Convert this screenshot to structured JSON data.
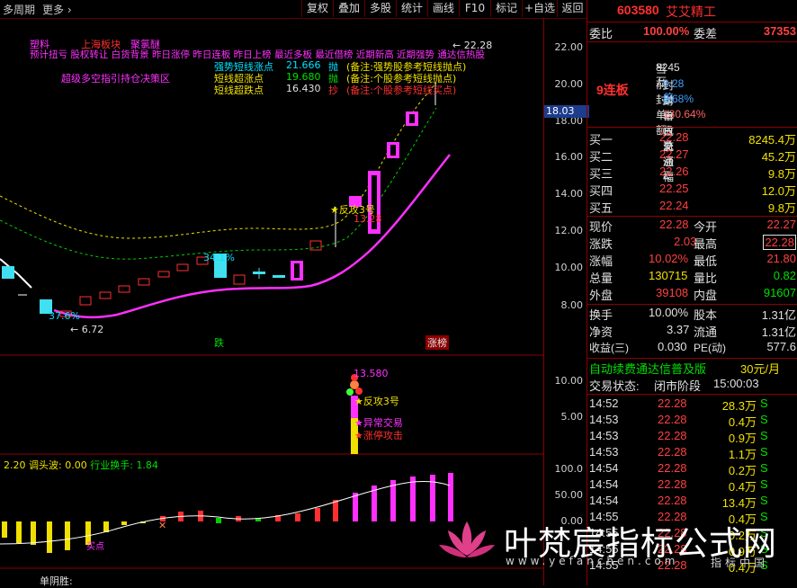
{
  "toolbar": {
    "period": "多周期",
    "more": "更多",
    "buttons": [
      "复权",
      "叠加",
      "多股",
      "统计",
      "画线",
      "F10",
      "标记",
      "+自选",
      "返回"
    ]
  },
  "chart": {
    "annotations": {
      "tag_plastic": "塑料",
      "tag_sector": "上海板块",
      "tag_polymer": "聚氯醚",
      "concept_line": "预计扭亏 股权转让 白货背景 昨日涨停 昨日连板 昨日上榜 最近多板 最近借榜 近期新高 近期强势 通达信热股",
      "super_long_bull": "超级多空指引持仓决策区",
      "strong_label": "强势短线涨点",
      "strong_value": "21.666",
      "strong_act": "抛",
      "strong_note": "(备注:强势股参考短线抛点)",
      "short_up_label": "短线超涨点",
      "short_up_value": "19.680",
      "short_up_act": "抛",
      "short_up_note": "(备注:个股参考短线抛点)",
      "short_down_label": "短线超跌点",
      "short_down_value": "16.430",
      "short_down_act": "抄",
      "short_down_note": "(备注:个股参考短线买点)",
      "high_mark": "22.28",
      "low_mark": "6.72",
      "pct_low": "37.6%",
      "pct_mid": "34.1%",
      "fangong_main": "反攻3号",
      "price_1328": "13.28",
      "die": "跌",
      "zhangbang": "涨榜",
      "price_axis_current": "18.03"
    },
    "price_axis": [
      "22.00",
      "20.00",
      "18.00",
      "16.00",
      "14.00",
      "12.00",
      "10.00",
      "8.00"
    ],
    "mid_axis": [
      "10.00",
      "5.00"
    ],
    "mid_annotations": {
      "value": "13.580",
      "fangong": "反攻3号",
      "yichang": "异常交易",
      "zhangting": "涨停攻击"
    },
    "lower_header": {
      "a": "2.20",
      "b_label": "调头波:",
      "b_value": "0.00",
      "c_label": "行业换手:",
      "c_value": "1.84"
    },
    "lower_axis": [
      "100.0",
      "50.00",
      "0.00"
    ],
    "bottom_label": "单阴胜:",
    "lower_tag": "买点",
    "watermark_cn": "叶梵宸指标公式网",
    "watermark_url": "www.yefanchen.com",
    "watermark_sub": "指标中国"
  },
  "quote": {
    "code": "603580",
    "name": "艾艾精工",
    "weibi_label": "委比",
    "weibi_value": "100.00%",
    "weicha_label": "委差",
    "weicha_value": "37353",
    "lianban": "9连板",
    "info": [
      {
        "label": "当前封单额",
        "value": "8245万"
      },
      {
        "label": "封单占成交",
        "value": "0.28倍"
      },
      {
        "label": "封单占流通Z",
        "value": "8.68%"
      },
      {
        "label": "十日总涨幅",
        "value": "130.64%"
      }
    ],
    "bids": [
      {
        "label": "买一",
        "price": "22.28",
        "vol": "8245.4万"
      },
      {
        "label": "买二",
        "price": "22.27",
        "vol": "45.2万"
      },
      {
        "label": "买三",
        "price": "22.26",
        "vol": "9.8万"
      },
      {
        "label": "买四",
        "price": "22.25",
        "vol": "12.0万"
      },
      {
        "label": "买五",
        "price": "22.24",
        "vol": "9.8万"
      }
    ],
    "stats": [
      {
        "l1": "现价",
        "v1": "22.28",
        "l2": "今开",
        "v2": "22.27"
      },
      {
        "l1": "涨跌",
        "v1": "2.03",
        "l2": "最高",
        "v2": "22.28"
      },
      {
        "l1": "涨幅",
        "v1": "10.02%",
        "l2": "最低",
        "v2": "21.80"
      },
      {
        "l1": "总量",
        "v1": "130715",
        "l2": "量比",
        "v2": "0.82"
      },
      {
        "l1": "外盘",
        "v1": "39108",
        "l2": "内盘",
        "v2": "91607"
      }
    ],
    "stats2": [
      {
        "l1": "换手",
        "v1": "10.00%",
        "l2": "股本",
        "v2": "1.31亿"
      },
      {
        "l1": "净资",
        "v1": "3.37",
        "l2": "流通",
        "v2": "1.31亿"
      },
      {
        "l1": "收益(三)",
        "v1": "0.030",
        "l2": "PE(动)",
        "v2": "577.6"
      }
    ],
    "promo": "自动续费通达信普及版",
    "promo_price": "30元/月",
    "status_label": "交易状态:",
    "status_value": "闭市阶段",
    "status_time": "15:00:03",
    "ticks": [
      {
        "t": "14:52",
        "p": "22.28",
        "v": "28.3万",
        "s": "S"
      },
      {
        "t": "14:53",
        "p": "22.28",
        "v": "0.4万",
        "s": "S"
      },
      {
        "t": "14:53",
        "p": "22.28",
        "v": "0.9万",
        "s": "S"
      },
      {
        "t": "14:53",
        "p": "22.28",
        "v": "1.1万",
        "s": "S"
      },
      {
        "t": "14:54",
        "p": "22.28",
        "v": "0.2万",
        "s": "S"
      },
      {
        "t": "14:54",
        "p": "22.28",
        "v": "0.4万",
        "s": "S"
      },
      {
        "t": "14:54",
        "p": "22.28",
        "v": "13.4万",
        "s": "S"
      },
      {
        "t": "14:55",
        "p": "22.28",
        "v": "0.4万",
        "s": "S"
      },
      {
        "t": "14:55",
        "p": "22.28",
        "v": "0.2万",
        "s": "S"
      },
      {
        "t": "14:55",
        "p": "22.28",
        "v": "0.9万",
        "s": "S"
      },
      {
        "t": "14:55",
        "p": "22.28",
        "v": "0.4万",
        "s": "S"
      }
    ]
  }
}
